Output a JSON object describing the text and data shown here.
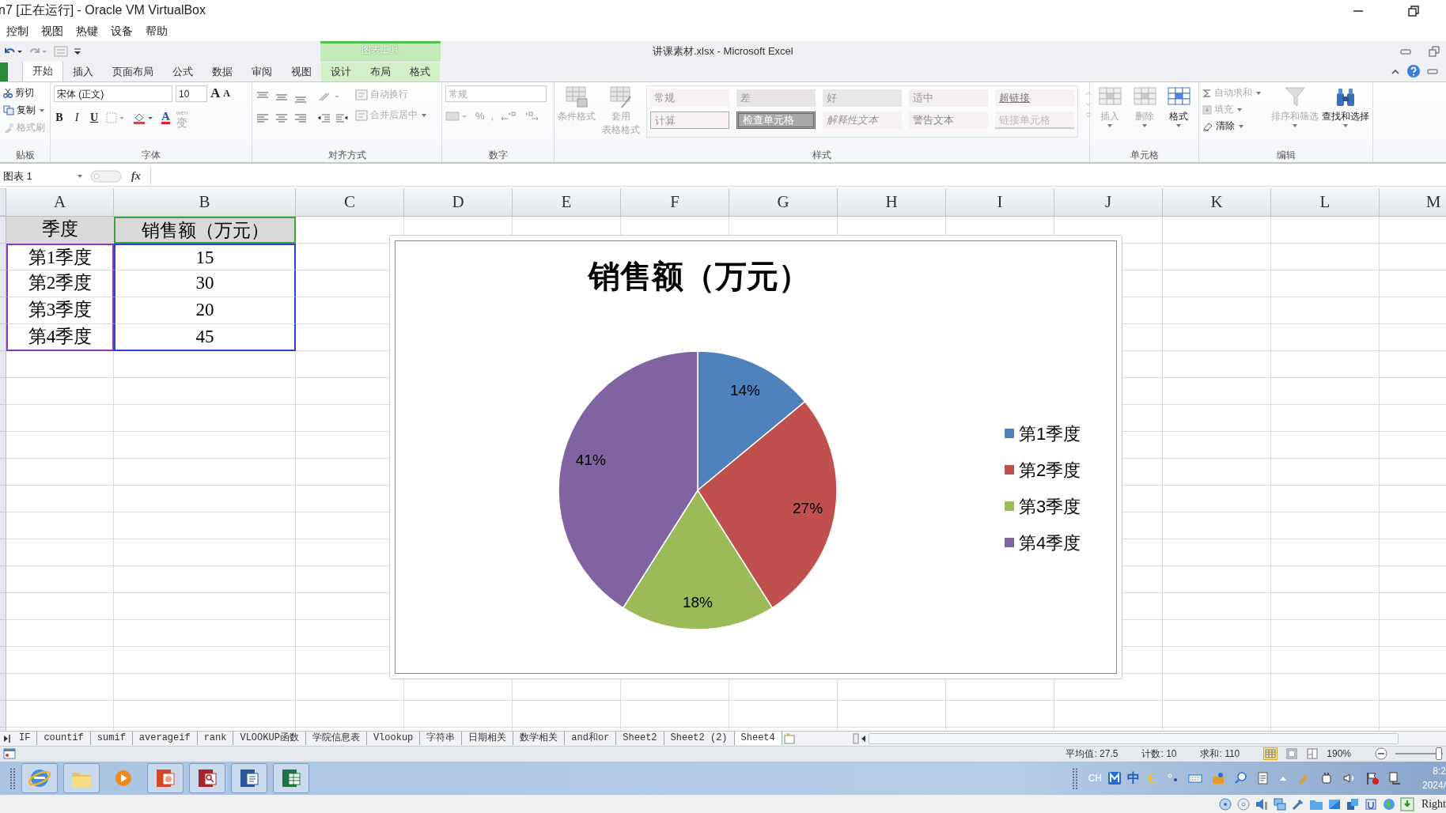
{
  "window": {
    "title": "n7 [正在运行] - Oracle VM VirtualBox"
  },
  "menu": [
    "控制",
    "视图",
    "热键",
    "设备",
    "帮助"
  ],
  "app_title": "讲课素材.xlsx  -  Microsoft Excel",
  "context_group": "图表工具",
  "tabs": [
    {
      "label": "开始",
      "selected": true,
      "context": false
    },
    {
      "label": "插入",
      "selected": false,
      "context": false
    },
    {
      "label": "页面布局",
      "selected": false,
      "context": false
    },
    {
      "label": "公式",
      "selected": false,
      "context": false
    },
    {
      "label": "数据",
      "selected": false,
      "context": false
    },
    {
      "label": "审阅",
      "selected": false,
      "context": false
    },
    {
      "label": "视图",
      "selected": false,
      "context": false
    },
    {
      "label": "设计",
      "selected": false,
      "context": true
    },
    {
      "label": "布局",
      "selected": false,
      "context": true
    },
    {
      "label": "格式",
      "selected": false,
      "context": true
    }
  ],
  "ribbon": {
    "groups": [
      {
        "kind": "clipboard",
        "label": "贴板",
        "items": [
          {
            "label": "剪切",
            "disabled": false
          },
          {
            "label": "复制",
            "disabled": false
          },
          {
            "label": "格式刷",
            "disabled": true
          }
        ]
      },
      {
        "kind": "font",
        "label": "字体",
        "font": "宋体 (正文)",
        "size": "10",
        "grow": "A",
        "shrink": "A",
        "styles": [
          "B",
          "I",
          "U"
        ],
        "color_letter": "A",
        "phonetic_top": "wén",
        "phonetic": "变"
      },
      {
        "kind": "alignment",
        "label": "对齐方式",
        "items": [
          {
            "label": "自动换行",
            "disabled": true
          },
          {
            "label": "合并后居中",
            "disabled": true
          }
        ]
      },
      {
        "kind": "number",
        "label": "数字",
        "format": "常规",
        "symbols": [
          "%",
          ","
        ]
      },
      {
        "kind": "styles",
        "label": "样式",
        "items": [
          {
            "lines": [
              "条件格式"
            ],
            "disabled": true
          },
          {
            "lines": [
              "套用",
              "表格格式"
            ],
            "disabled": true
          }
        ],
        "gallery": [
          {
            "label": "常规",
            "kind": "normal"
          },
          {
            "label": "差",
            "kind": "bad"
          },
          {
            "label": "好",
            "kind": "good"
          },
          {
            "label": "适中",
            "kind": "neutral"
          },
          {
            "label": "超链接",
            "kind": "hyperlink"
          },
          {
            "label": "计算",
            "kind": "calculation"
          },
          {
            "label": "检查单元格",
            "kind": "check"
          },
          {
            "label": "解释性文本",
            "kind": "explanatory"
          },
          {
            "label": "警告文本",
            "kind": "warning"
          },
          {
            "label": "链接单元格",
            "kind": "linked"
          }
        ]
      },
      {
        "kind": "cells",
        "label": "单元格",
        "items": [
          {
            "label": "插入",
            "disabled": true
          },
          {
            "label": "删除",
            "disabled": true
          },
          {
            "label": "格式",
            "disabled": false
          }
        ]
      },
      {
        "kind": "editing",
        "label": "编辑",
        "items": [
          {
            "label": "自动求和",
            "disabled": true
          },
          {
            "label": "填充",
            "disabled": true
          },
          {
            "label": "清除",
            "disabled": false
          },
          {
            "label": "排序和筛选",
            "disabled": true
          },
          {
            "label": "查找和选择",
            "disabled": false
          }
        ]
      }
    ]
  },
  "formula_bar": {
    "name_box": "图表 1",
    "fx": "fx"
  },
  "sheet": {
    "columns": [
      "A",
      "B",
      "C",
      "D",
      "E",
      "F",
      "G",
      "H",
      "I",
      "J",
      "K",
      "L",
      "M"
    ],
    "rows": [
      {
        "cells": [
          {
            "text": "季度",
            "header": true,
            "kind": "plain"
          },
          {
            "text": "销售额（万元）",
            "header": true,
            "kind": "series_name"
          }
        ]
      },
      {
        "cells": [
          {
            "text": "第1季度",
            "header": false,
            "kind": "category"
          },
          {
            "text": "15",
            "header": false,
            "kind": "value"
          }
        ]
      },
      {
        "cells": [
          {
            "text": "第2季度",
            "header": false,
            "kind": "category"
          },
          {
            "text": "30",
            "header": false,
            "kind": "value"
          }
        ]
      },
      {
        "cells": [
          {
            "text": "第3季度",
            "header": false,
            "kind": "category"
          },
          {
            "text": "20",
            "header": false,
            "kind": "value"
          }
        ]
      },
      {
        "cells": [
          {
            "text": "第4季度",
            "header": false,
            "kind": "category"
          },
          {
            "text": "45",
            "header": false,
            "kind": "value"
          }
        ]
      }
    ],
    "chart": {
      "chart_data": {
        "type": "pie",
        "categories": [
          "第1季度",
          "第2季度",
          "第3季度",
          "第4季度"
        ],
        "series": [
          {
            "name": "销售额（万元）",
            "values": [
              14,
              27,
              18,
              41
            ]
          }
        ],
        "colors": [
          "#4f81bd",
          "#c0504d",
          "#9bbb59",
          "#8064a2"
        ],
        "data_labels": "value_labels",
        "value_labels": [
          "14%",
          "27%",
          "18%",
          "41%"
        ],
        "legend": "right"
      }
    }
  },
  "sheet_tabs": [
    {
      "label": "IF",
      "selected": false
    },
    {
      "label": "countif",
      "selected": false
    },
    {
      "label": "sumif",
      "selected": false
    },
    {
      "label": "averageif",
      "selected": false
    },
    {
      "label": "rank",
      "selected": false
    },
    {
      "label": "VLOOKUP函数",
      "selected": false
    },
    {
      "label": "学院信息表",
      "selected": false
    },
    {
      "label": "Vlookup",
      "selected": false
    },
    {
      "label": "字符串",
      "selected": false
    },
    {
      "label": "日期相关",
      "selected": false
    },
    {
      "label": "数学相关",
      "selected": false
    },
    {
      "label": "and和or",
      "selected": false
    },
    {
      "label": "Sheet2",
      "selected": false
    },
    {
      "label": "Sheet2 (2)",
      "selected": false
    },
    {
      "label": "Sheet4",
      "selected": true
    }
  ],
  "status_bar": {
    "average": "平均值: 27.5",
    "count": "计数: 10",
    "sum": "求和: 110",
    "zoom": "190%",
    "level": 0.9
  },
  "taskbar": {
    "ime": "CH",
    "ime_mode": "中",
    "time": "8:2",
    "date": "2024/"
  },
  "vbox_status": {
    "host_key": "Right"
  }
}
